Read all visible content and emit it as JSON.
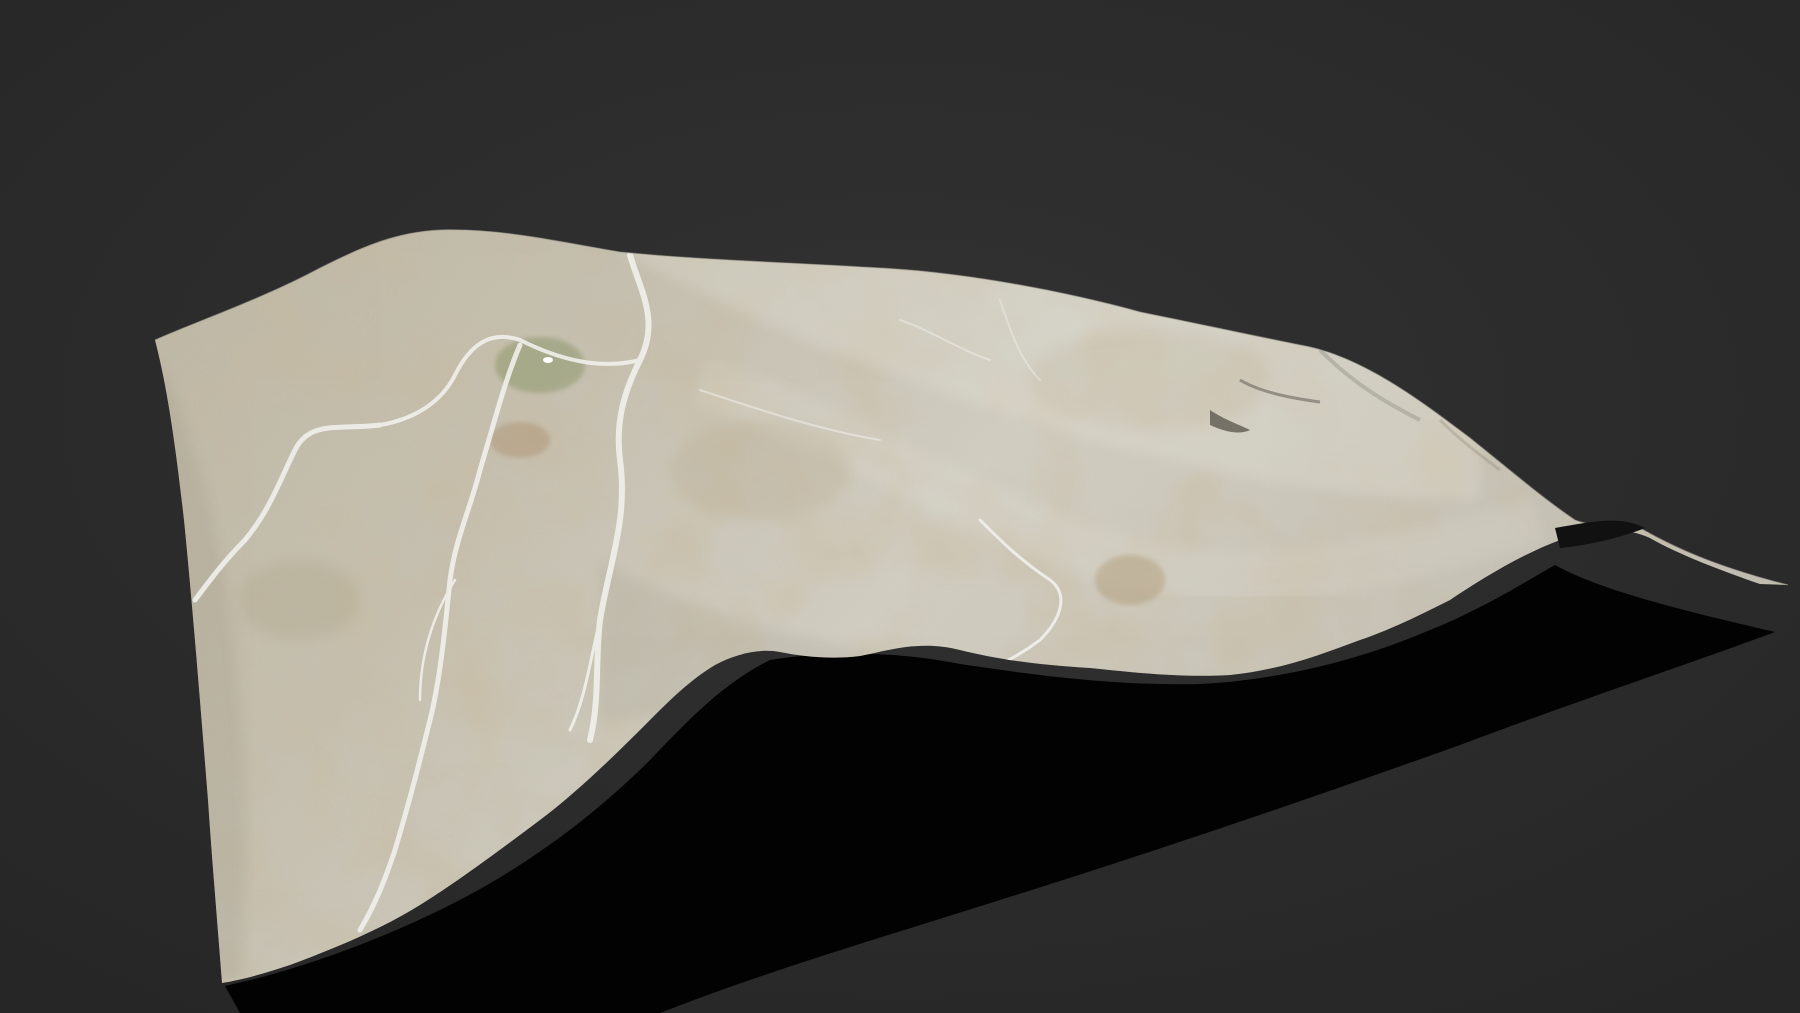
{
  "scene": {
    "subject": "terrain-mesh",
    "background_color": "#2b2b2b",
    "shadow_color": "#000000",
    "terrain_colors": {
      "base": "#c6c2b4",
      "light": "#dedbd0",
      "warm_patch": "#b39f7b",
      "green_patch": "#93a07a",
      "gully": "#ecebe6",
      "dark_edge": "#7e7a70"
    }
  }
}
